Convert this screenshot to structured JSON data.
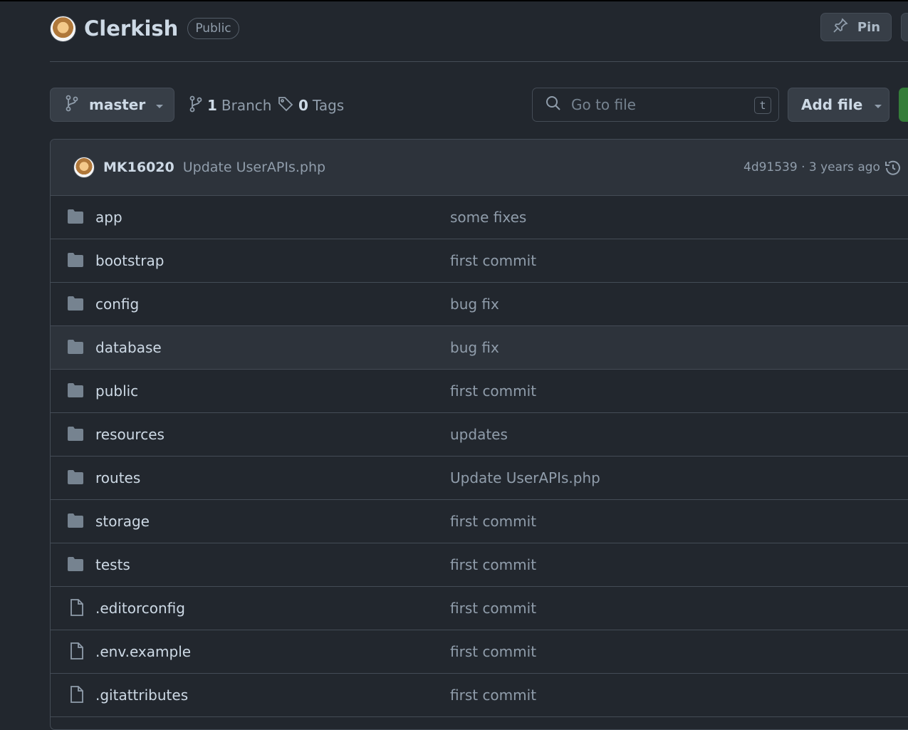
{
  "repo": {
    "name": "Clerkish",
    "visibility": "Public"
  },
  "actions": {
    "pin_label": "Pin"
  },
  "toolbar": {
    "branch": "master",
    "branches_count": "1",
    "branches_label": "Branch",
    "tags_count": "0",
    "tags_label": "Tags",
    "search_placeholder": "Go to file",
    "search_shortcut": "t",
    "add_file_label": "Add file"
  },
  "latest_commit": {
    "author": "MK16020",
    "message": "Update UserAPIs.php",
    "hash": "4d91539",
    "separator": " · ",
    "age": "3 years ago"
  },
  "files": [
    {
      "name": "app",
      "type": "dir",
      "commit": "some fixes"
    },
    {
      "name": "bootstrap",
      "type": "dir",
      "commit": "first commit"
    },
    {
      "name": "config",
      "type": "dir",
      "commit": "bug fix"
    },
    {
      "name": "database",
      "type": "dir",
      "commit": "bug fix"
    },
    {
      "name": "public",
      "type": "dir",
      "commit": "first commit"
    },
    {
      "name": "resources",
      "type": "dir",
      "commit": "updates"
    },
    {
      "name": "routes",
      "type": "dir",
      "commit": "Update UserAPIs.php"
    },
    {
      "name": "storage",
      "type": "dir",
      "commit": "first commit"
    },
    {
      "name": "tests",
      "type": "dir",
      "commit": "first commit"
    },
    {
      "name": ".editorconfig",
      "type": "file",
      "commit": "first commit"
    },
    {
      "name": ".env.example",
      "type": "file",
      "commit": "first commit"
    },
    {
      "name": ".gitattributes",
      "type": "file",
      "commit": "first commit"
    }
  ],
  "colors": {
    "background": "#22272e",
    "panel": "#2d333b",
    "border": "#444c56",
    "accent_green": "#347d39",
    "icon_folder": "#768390"
  }
}
